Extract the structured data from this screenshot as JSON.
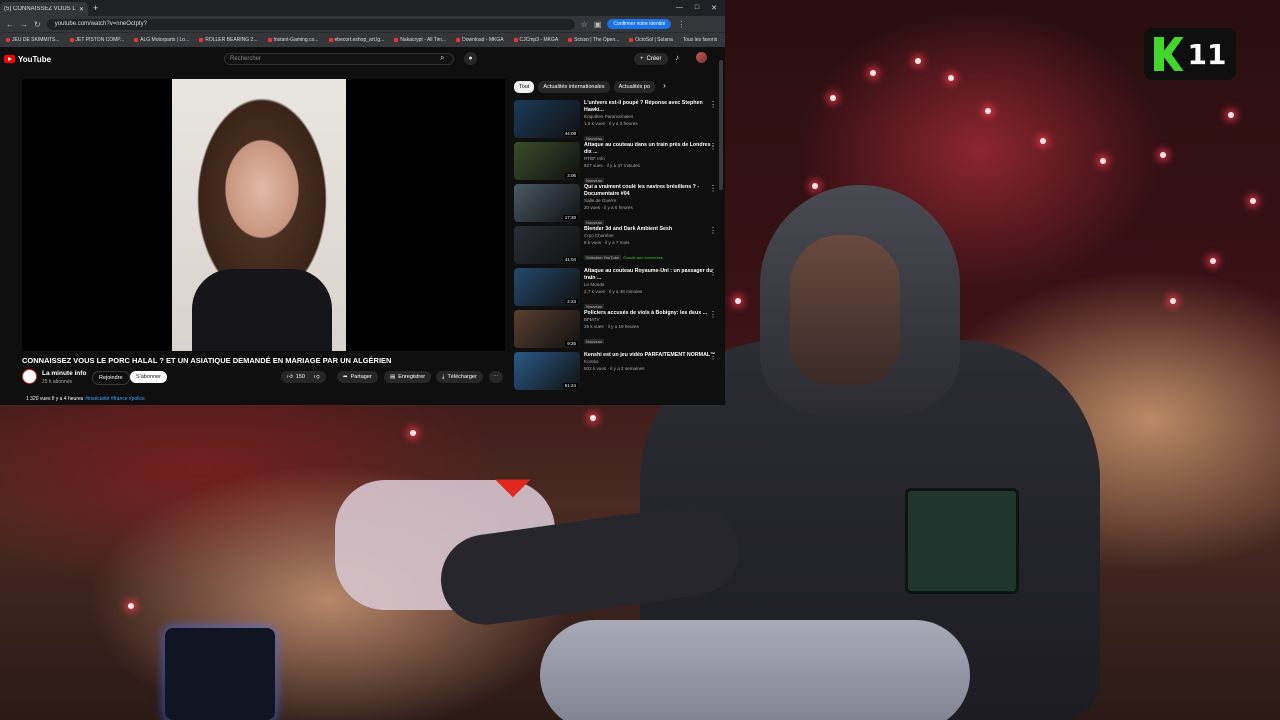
{
  "browser": {
    "tab_title": "(5) CONNAISSEZ VOUS LE",
    "url": "youtube.com/watch?v=nneOctpty?",
    "confirm_identity": "Confirmer votre identité",
    "bookmarks": [
      "JEU DE SKIMMITS...",
      "JET PISTON COMP...",
      "ALG Motorparts | Lo...",
      "ROLLER BEARING 2...",
      "Instant-Gaming.co...",
      "ebecort.eshop_art.lg...",
      "Nakacrypt - All Tim...",
      "Download - MKGA",
      "CJCmp3 - MKGA",
      "Scisso | The Open...",
      "OctoSol | Solana",
      "Tous les favoris"
    ]
  },
  "youtube": {
    "logo": "YouTube",
    "search_placeholder": "Rechercher",
    "create_label": "Créer"
  },
  "video": {
    "title": "CONNAISSEZ VOUS LE PORC HALAL ? ET UN ASIATIQUE DEMANDÉ EN MARIAGE PAR UN ALGÉRIEN",
    "channel": "La minute info",
    "subscribers": "25 k abonnés",
    "join_label": "Rejoindre",
    "subscribed_label": "S'abonner",
    "likes": "150",
    "share_label": "Partager",
    "save_label": "Enregistrer",
    "download_label": "Télécharger",
    "stats": "1 320 vues  Il y a 4 heures",
    "tags": "#insécurité #france #police"
  },
  "chips": [
    "Tout",
    "Actualités internationales",
    "Actualités po"
  ],
  "recommendations": [
    {
      "title": "L'univers est-il poupé ? Réponse avec Stephen Hawki...",
      "channel": "Enquêtes Paranormales",
      "meta": "1,6 k vues · il y a 3 heures",
      "badge": "Nouveau",
      "duration": "44:09",
      "color": "#1b3b5a"
    },
    {
      "title": "Attaque au couteau dans un train près de Londres : dix ...",
      "channel": "RTBF Info",
      "meta": "627 vues · il y a 37 minutes",
      "badge": "Nouveau",
      "duration": "3:06",
      "color": "#3a4d2a"
    },
    {
      "title": "Qui a vraiment coulé les navires brésiliens ? - Documentaire #04",
      "channel": "Salle de Guerre",
      "meta": "20 vues · il y a 5 heures",
      "badge": "Nouveau",
      "duration": "17:30",
      "color": "#4a5a66"
    },
    {
      "title": "Blender 3d and Dark Ambient Sesh",
      "channel": "Cryo Chamber",
      "meta": "8 k vues · il y a 7 mois",
      "badge": "Sélection YouTube",
      "badge2": "Écouté aux éminentes",
      "duration": "41:04",
      "color": "#2a2f36"
    },
    {
      "title": "Attaque au couteau Royaume-Uni : un passager du train ...",
      "channel": "Le Monde",
      "meta": "2,7 k vues · il y a 48 minutes",
      "badge": "Nouveau",
      "duration": "2:23",
      "color": "#244a6e"
    },
    {
      "title": "Policiers accusés de viols à Bobigny: les deux ...",
      "channel": "BFMTV",
      "meta": "26 k vues · il y a 19 heures",
      "badge": "Nouveau",
      "duration": "9:25",
      "color": "#5a4030"
    },
    {
      "title": "Kenshi est un jeu vidéo PARFAITEMENT NORMAL™",
      "channel": "Kombo",
      "meta": "502 k vues · il y a 2 semaines",
      "badge": "",
      "duration": "51:24",
      "color": "#2a5a8a"
    }
  ],
  "overlay": {
    "logo_number": "11"
  }
}
